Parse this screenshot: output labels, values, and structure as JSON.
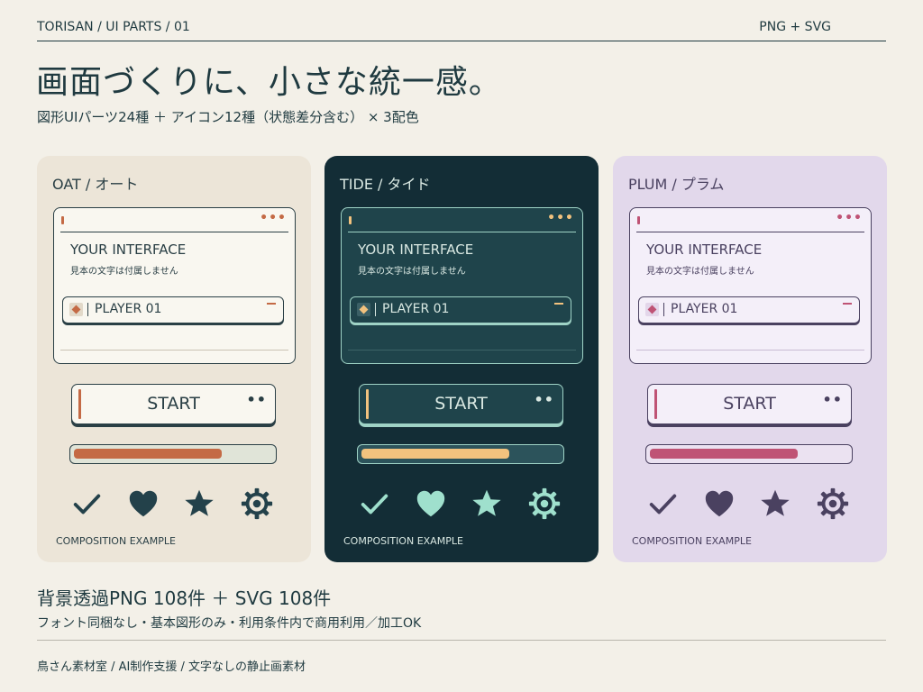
{
  "header": {
    "breadcrumb": "TORISAN / UI PARTS / 01",
    "formats": "PNG + SVG"
  },
  "headline": "画面づくりに、小さな統一感。",
  "subline": "図形UIパーツ24種 ＋ アイコン12種（状態差分含む） × 3配色",
  "themes": [
    {
      "title": "OAT / オート",
      "panel_heading": "YOUR INTERFACE",
      "panel_caption": "見本の文字は付属しません",
      "panel_dots": "•••",
      "field_label": "PLAYER 01",
      "button_label": "START",
      "button_dots": "••",
      "progress": 0.75,
      "footer": "COMPOSITION EXAMPLE",
      "icons": [
        "check-icon",
        "heart-icon",
        "star-icon",
        "gear-icon"
      ],
      "colors": {
        "card": "#ece5d8",
        "title": "#2a3f45",
        "panel_bg": "#f9f7f0",
        "panel_border": "#2a3f45",
        "rule": "#2a3f45",
        "text": "#2a3f45",
        "accent": "#c46a45",
        "field_bg": "#f9f7f0",
        "gem_bg": "#e2d9c9",
        "track": "#e0e4d8",
        "icon": "#23414a",
        "lowrule": "#c9c2b3"
      }
    },
    {
      "title": "TIDE / タイド",
      "panel_heading": "YOUR INTERFACE",
      "panel_caption": "見本の文字は付属しません",
      "panel_dots": "•••",
      "field_label": "PLAYER 01",
      "button_label": "START",
      "button_dots": "••",
      "progress": 0.75,
      "footer": "COMPOSITION EXAMPLE",
      "icons": [
        "check-icon",
        "heart-icon",
        "star-icon",
        "gear-icon"
      ],
      "colors": {
        "card": "#132d36",
        "title": "#d9e8e2",
        "panel_bg": "#1f444b",
        "panel_border": "#9fd3c6",
        "rule": "#9fd3c6",
        "text": "#d9e8e2",
        "accent": "#f2c27e",
        "field_bg": "#1f444b",
        "gem_bg": "#3b6066",
        "track": "#2c535b",
        "icon": "#9fe0cd",
        "lowrule": "#3c6467"
      }
    },
    {
      "title": "PLUM / プラム",
      "panel_heading": "YOUR INTERFACE",
      "panel_caption": "見本の文字は付属しません",
      "panel_dots": "•••",
      "field_label": "PLAYER 01",
      "button_label": "START",
      "button_dots": "••",
      "progress": 0.75,
      "footer": "COMPOSITION EXAMPLE",
      "icons": [
        "check-icon",
        "heart-icon",
        "star-icon",
        "gear-icon"
      ],
      "colors": {
        "card": "#e2d8eb",
        "title": "#4a4160",
        "panel_bg": "#f4eff9",
        "panel_border": "#4a4160",
        "rule": "#4a4160",
        "text": "#4a4160",
        "accent": "#bf5375",
        "field_bg": "#f4eff9",
        "gem_bg": "#e3d6ea",
        "track": "#ebe2f1",
        "icon": "#4a4160",
        "lowrule": "#c8bcd3"
      }
    }
  ],
  "summary": {
    "title": "背景透過PNG 108件 ＋ SVG 108件",
    "sub": "フォント同梱なし・基本図形のみ・利用条件内で商用利用／加工OK"
  },
  "credit": "鳥さん素材室 / AI制作支援 / 文字なしの静止画素材"
}
